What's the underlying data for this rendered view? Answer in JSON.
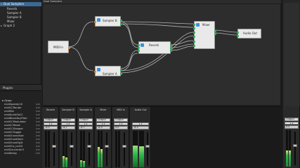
{
  "graph_tree": {
    "items": [
      {
        "label": "Dual Samplers",
        "selected": true,
        "indent": 1
      },
      {
        "label": "Reverb",
        "selected": false,
        "indent": 2
      },
      {
        "label": "Sampler A",
        "selected": false,
        "indent": 2
      },
      {
        "label": "Sampler B",
        "selected": false,
        "indent": 2
      },
      {
        "label": "Mixer",
        "selected": false,
        "indent": 2
      },
      {
        "label": "Graph 2",
        "selected": false,
        "indent": 1
      }
    ]
  },
  "plugins": {
    "header": "Plugins",
    "category": "Other",
    "items": [
      {
        "name": "midiSpeedy16",
        "type": "lvel"
      },
      {
        "name": "midiCCRouter",
        "type": "lvel"
      },
      {
        "name": "midiMix",
        "type": "lvel"
      },
      {
        "name": "midiAudioToCC",
        "type": "lvel"
      },
      {
        "name": "midiBlackKeyFilter",
        "type": "lvel"
      },
      {
        "name": "midiCCModulator",
        "type": "lvel"
      },
      {
        "name": "midiCCReset",
        "type": "lvel"
      },
      {
        "name": "midiCCStepper",
        "type": "lvel"
      },
      {
        "name": "midiCCToggle",
        "type": "lvel"
      },
      {
        "name": "midiChannelize",
        "type": "lvel"
      },
      {
        "name": "midiChordHold",
        "type": "lvel"
      },
      {
        "name": "midiChordSplit",
        "type": "lvel"
      },
      {
        "name": "midiChs_noOG",
        "type": "lvel"
      },
      {
        "name": "midiConverter3",
        "type": "lvel"
      },
      {
        "name": "midiDelay",
        "type": "lvel"
      }
    ]
  },
  "canvas": {
    "title": "Dual Samplers",
    "nodes": {
      "midi_in": "MIDI In",
      "sampler_b": "Sampler B",
      "sampler_a": "Sampler A",
      "reverb": "Reverb",
      "mixer": "Mixer",
      "audio_out": "Audio Out"
    }
  },
  "mixer": {
    "strips": [
      {
        "name": "Reverb",
        "output": "Output",
        "io": "1 2",
        "db": "-6.9",
        "level": 0.0,
        "fader": 0.55
      },
      {
        "name": "Sampler B",
        "output": "Output",
        "io": "1 2",
        "db": "-6.7",
        "level": 0.3,
        "fader": 0.55
      },
      {
        "name": "Sampler A",
        "output": "Output",
        "io": "1 2",
        "db": "-6.7",
        "level": 0.2,
        "fader": 0.55
      },
      {
        "name": "Mixer",
        "output": "Output",
        "io": "1 2",
        "db": "-6.3",
        "level": 0.55,
        "fader": 0.55
      },
      {
        "name": "MIDI In",
        "output": "Output",
        "io": "1 2",
        "db": "0.0",
        "level": 0.0,
        "fader": 0.55
      },
      {
        "name": "Audio Out",
        "output": "",
        "io": "1 2",
        "db": "-6.3",
        "level": 0.6,
        "fader": 0.55
      }
    ],
    "master": {
      "output": "Output",
      "io": "1 2",
      "db": "0.0",
      "level": 0.45
    }
  },
  "colors": {
    "audio_port": "#2fae55",
    "midi_port": "#e08a2a",
    "control_port": "#d23b3b",
    "node_icon": "#3d8fd8",
    "selection": "#3a6a95"
  }
}
